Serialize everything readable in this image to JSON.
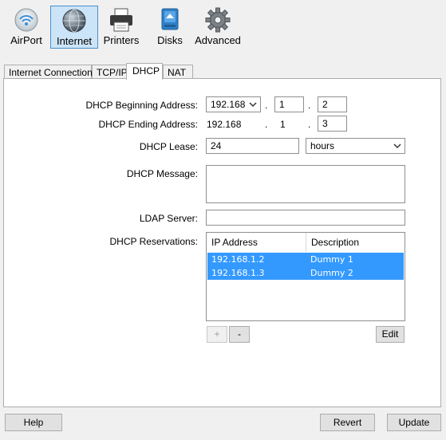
{
  "toolbar": {
    "items": [
      {
        "label": "AirPort",
        "icon": "wifi-icon"
      },
      {
        "label": "Internet",
        "icon": "globe-icon",
        "active": true
      },
      {
        "label": "Printers",
        "icon": "printer-icon"
      },
      {
        "label": "Disks",
        "icon": "disk-icon"
      },
      {
        "label": "Advanced",
        "icon": "gear-icon"
      }
    ]
  },
  "tabs": [
    {
      "label": "Internet Connection"
    },
    {
      "label": "TCP/IP"
    },
    {
      "label": "DHCP",
      "active": true
    },
    {
      "label": "NAT"
    }
  ],
  "form": {
    "begin_label": "DHCP Beginning Address:",
    "begin_prefix": "192.168",
    "begin_octet3": "1",
    "begin_octet4": "2",
    "end_label": "DHCP Ending Address:",
    "end_prefix": "192.168",
    "end_octet3": "1",
    "end_octet4": "3",
    "dot": ".",
    "lease_label": "DHCP Lease:",
    "lease_value": "24",
    "lease_unit": "hours",
    "message_label": "DHCP Message:",
    "message_value": "",
    "ldap_label": "LDAP Server:",
    "ldap_value": "",
    "reservations_label": "DHCP Reservations:"
  },
  "reservations": {
    "columns": [
      "IP Address",
      "Description"
    ],
    "rows": [
      {
        "ip": "192.168.1.2",
        "description": "Dummy 1"
      },
      {
        "ip": "192.168.1.3",
        "description": "Dummy 2"
      }
    ],
    "add_label": "+",
    "remove_label": "-",
    "edit_label": "Edit"
  },
  "footer": {
    "help_label": "Help",
    "revert_label": "Revert",
    "update_label": "Update"
  },
  "colors": {
    "selection": "#3399ff",
    "active_toolbar_bg": "#cce4f7"
  }
}
